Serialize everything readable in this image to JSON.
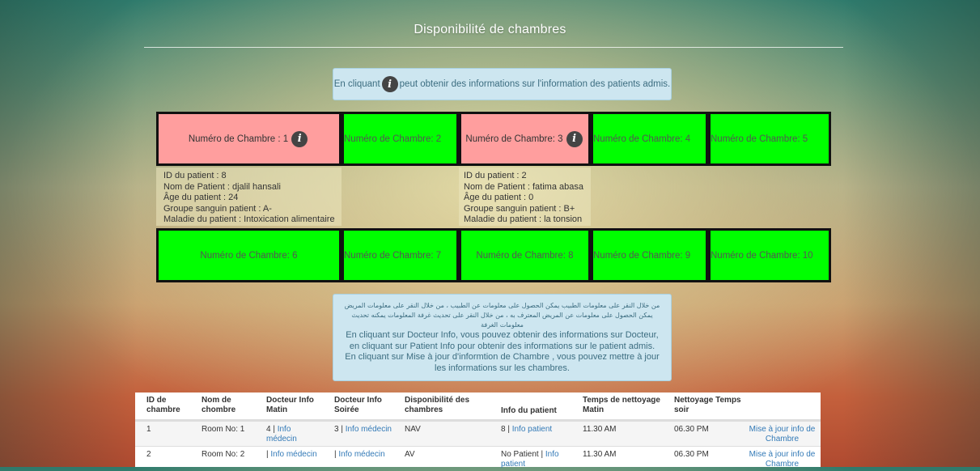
{
  "page_title": "Disponibilité de chambres",
  "info_banner": {
    "before": "En cliquant",
    "after": "peut obtenir des informations sur l'information des patients admis."
  },
  "rooms_row1": [
    {
      "label": "Numéro de Chambre : 1",
      "status": "occupied",
      "has_info": true
    },
    {
      "label": "Numéro de Chambre: 2",
      "status": "available"
    },
    {
      "label": "Numéro de Chambre: 3",
      "status": "occupied",
      "has_info": true
    },
    {
      "label": "Numéro de Chambre: 4",
      "status": "available"
    },
    {
      "label": "Numéro de Chambre: 5",
      "status": "available"
    }
  ],
  "rooms_row2": [
    {
      "label": "Numéro de Chambre: 6",
      "status": "available"
    },
    {
      "label": "Numéro de Chambre: 7",
      "status": "available"
    },
    {
      "label": "Numéro de Chambre: 8",
      "status": "available"
    },
    {
      "label": "Numéro de Chambre: 9",
      "status": "available"
    },
    {
      "label": "Numéro de Chambre: 10",
      "status": "available"
    }
  ],
  "patients": [
    {
      "id": "ID du patient : 8",
      "name": "Nom de Patient : djalil hansali",
      "age": "Âge du patient : 24",
      "blood": "Groupe sanguin patient : A-",
      "disease": "Maladie du patient : Intoxication alimentaire"
    },
    {
      "id": "ID du patient : 2",
      "name": "Nom de Patient : fatima abasa",
      "age": "Âge du patient : 0",
      "blood": "Groupe sanguin patient : B+",
      "disease": "Maladie du patient : la tonsion"
    }
  ],
  "help_box": {
    "arabic": "من خلال النقر على معلومات الطبيب يمكن الحصول على معلومات عن الطبيب ، من خلال النقر على معلومات المريض يمكن الحصول على معلومات عن المريض المعترف به ، من خلال النقر على تحديث غرفة المعلومات يمكنه تحديث معلومات الغرفة",
    "french": "En cliquant sur Docteur Info, vous pouvez obtenir des informations sur Docteur, en cliquant sur Patient Info pour obtenir des informations sur le patient admis. En cliquant sur Mise à jour d'informtion de Chambre , vous pouvez mettre à jour les informations sur les chambres."
  },
  "table": {
    "headers": [
      "ID de chambre",
      "Nom de chombre",
      "Docteur Info Matin",
      "Docteur Info Soirée",
      "Disponibilité des chambres",
      "Info du patient",
      "Temps de nettoyage Matin",
      "Nettoyage Temps soir",
      ""
    ],
    "rows": [
      {
        "id": "1",
        "name": "Room No: 1",
        "doc_morning_num": "4 | ",
        "doc_morning_link": "Info médecin",
        "doc_evening_num": "3 | ",
        "doc_evening_link": "Info médecin",
        "availability": "NAV",
        "patient_prefix": "8 | ",
        "patient_link": "Info patient",
        "clean_morning": "11.30 AM",
        "clean_evening": "06.30 PM",
        "update_link": "Mise à jour info de Chambre"
      },
      {
        "id": "2",
        "name": "Room No: 2",
        "doc_morning_num": "| ",
        "doc_morning_link": "Info médecin",
        "doc_evening_num": "| ",
        "doc_evening_link": "Info médecin",
        "availability": "AV",
        "patient_prefix": "No Patient | ",
        "patient_link": "Info patient",
        "clean_morning": "11.30 AM",
        "clean_evening": "06.30 PM",
        "update_link": "Mise à jour info de Chambre"
      }
    ]
  },
  "colors": {
    "available": "#00ff00",
    "occupied": "#ff9e9e",
    "link": "#337ab7",
    "info_box": "#cde6f0"
  },
  "icons": {
    "info": "info-circle-icon"
  }
}
